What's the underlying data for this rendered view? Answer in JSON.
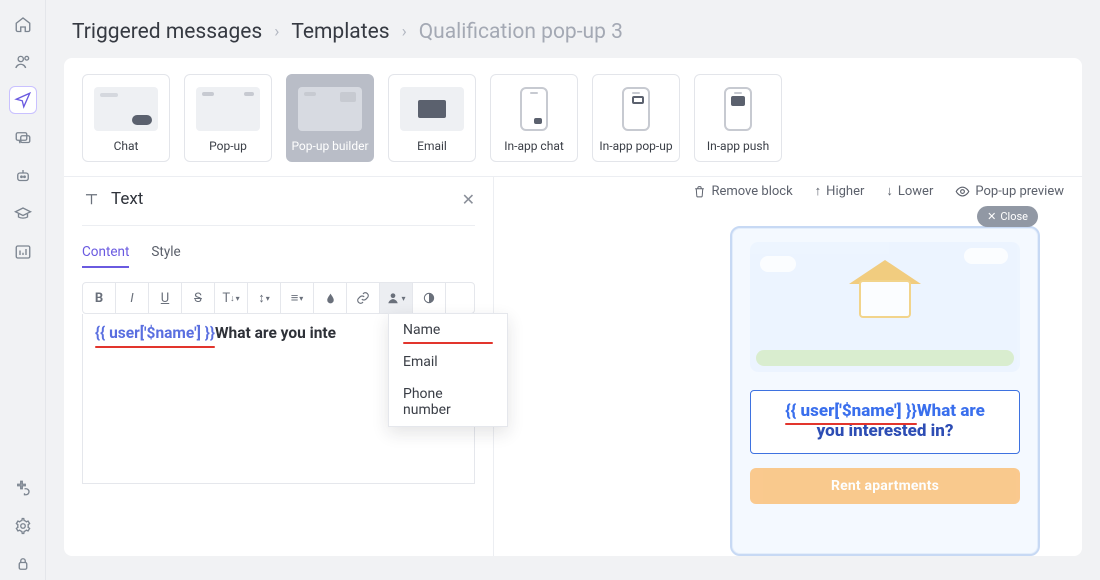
{
  "breadcrumbs": {
    "root": "Triggered messages",
    "mid": "Templates",
    "current": "Qualification pop-up 3"
  },
  "message_types": {
    "chat": "Chat",
    "popup": "Pop-up",
    "popup_builder": "Pop-up builder",
    "email": "Email",
    "inapp_chat": "In-app chat",
    "inapp_popup": "In-app pop-up",
    "inapp_push": "In-app push"
  },
  "editor": {
    "block_title": "Text",
    "tabs": {
      "content": "Content",
      "style": "Style"
    },
    "toolbar_icons": {
      "bold": "B",
      "italic": "I",
      "underline": "U",
      "strike": "S",
      "textsize": "T",
      "lineheight": "↕",
      "align": "≡",
      "fill": "💧",
      "link": "🔗",
      "user": "user",
      "contrast": "◐"
    },
    "personalization_menu": {
      "name": "Name",
      "email": "Email",
      "phone": "Phone number"
    },
    "content_token": "{{ user['$name'] }}",
    "content_rest": "What are you interested in?",
    "content_rest_truncated": "What are you inte"
  },
  "preview": {
    "actions": {
      "remove": "Remove block",
      "higher": "Higher",
      "lower": "Lower",
      "popup_preview": "Pop-up preview"
    },
    "close": "Close",
    "heading_token": "{{ user['$name'] }}",
    "heading_rest1": "What are",
    "heading_rest2": "you interested in?",
    "cta": "Rent apartments"
  }
}
